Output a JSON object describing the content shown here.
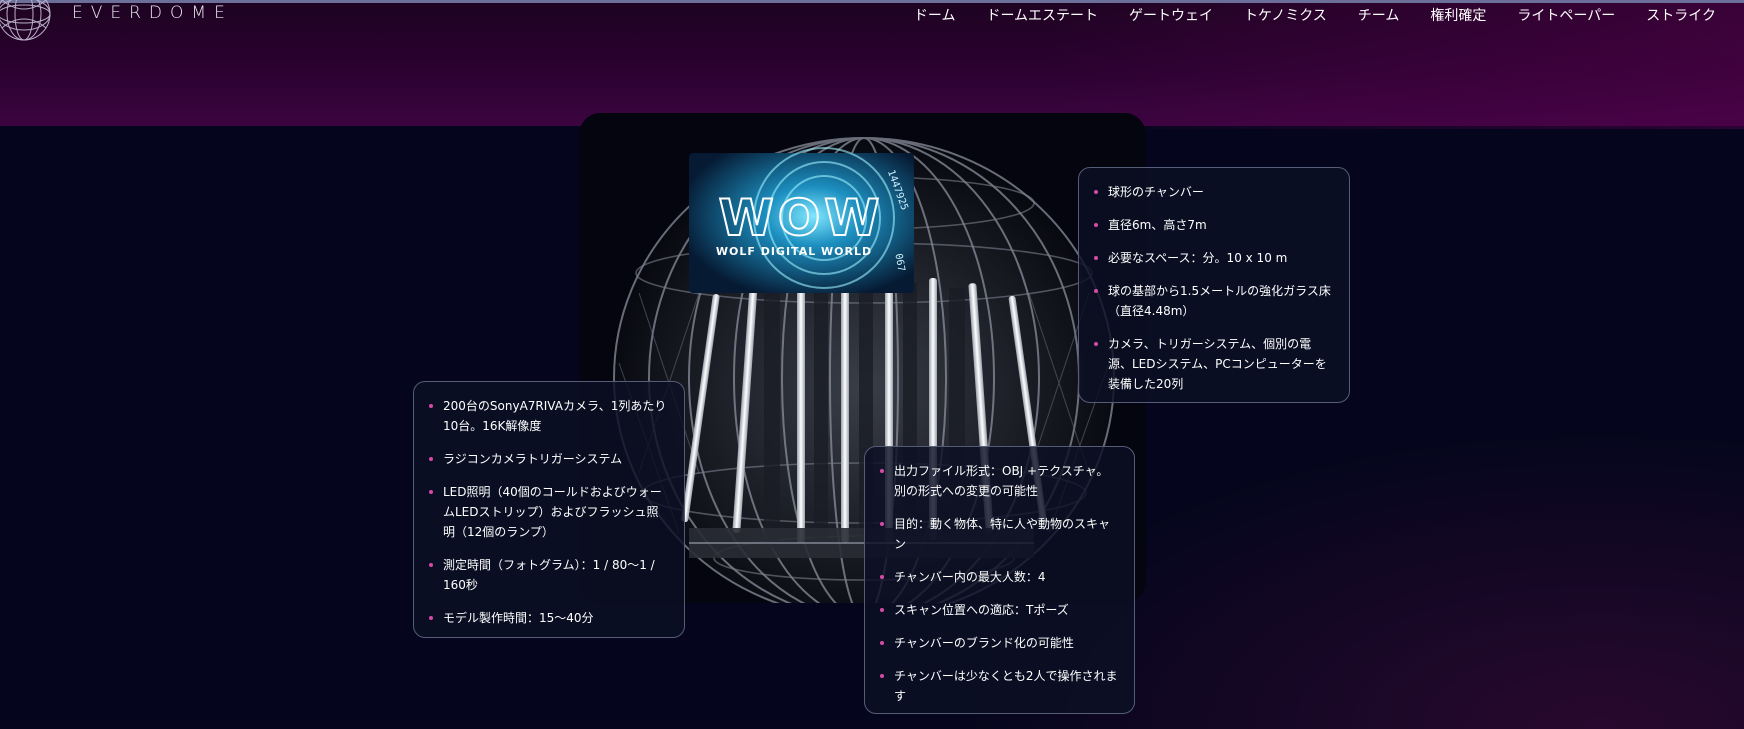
{
  "brand": {
    "name": "EVERDOME"
  },
  "nav": {
    "items": [
      "ドーム",
      "ドームエステート",
      "ゲートウェイ",
      "トケノミクス",
      "チーム",
      "権利確定",
      "ライトペーパー",
      "ストライク"
    ]
  },
  "dome_image": {
    "screen_title": "WOW",
    "screen_subtitle": "WOLF DIGITAL WORLD",
    "screen_number_top": "1447925",
    "screen_number_side": "067"
  },
  "card_right": {
    "items": [
      "球形のチャンバー",
      "直径6m、高さ7m",
      "必要なスペース：分。10 x 10 m",
      "球の基部から1.5メートルの強化ガラス床（直径4.48m）",
      "カメラ、トリガーシステム、個別の電源、LEDシステム、PCコンピューターを装備した20列"
    ]
  },
  "card_left": {
    "items": [
      "200台のSonyA7RIVAカメラ、1列あたり10台。16K解像度",
      "ラジコンカメラトリガーシステム",
      "LED照明（40個のコールドおよびウォームLEDストリップ）およびフラッシュ照明（12個のランプ）",
      "測定時間（フォトグラム）：1 / 80〜1 / 160秒",
      "モデル製作時間：15〜40分"
    ]
  },
  "card_bottom": {
    "items": [
      "出力ファイル形式：OBJ +テクスチャ。別の形式への変更の可能性",
      "目的：動く物体、特に人や動物のスキャン",
      "チャンバー内の最大人数：4",
      "スキャン位置への適応：Tポーズ",
      "チャンバーのブランド化の可能性",
      "チャンバーは少なくとも2人で操作されます"
    ]
  },
  "colors": {
    "background": "#05061d",
    "hero_band": "#2b0230",
    "bullet": "#d64aa5",
    "card_border": "#565b78"
  }
}
